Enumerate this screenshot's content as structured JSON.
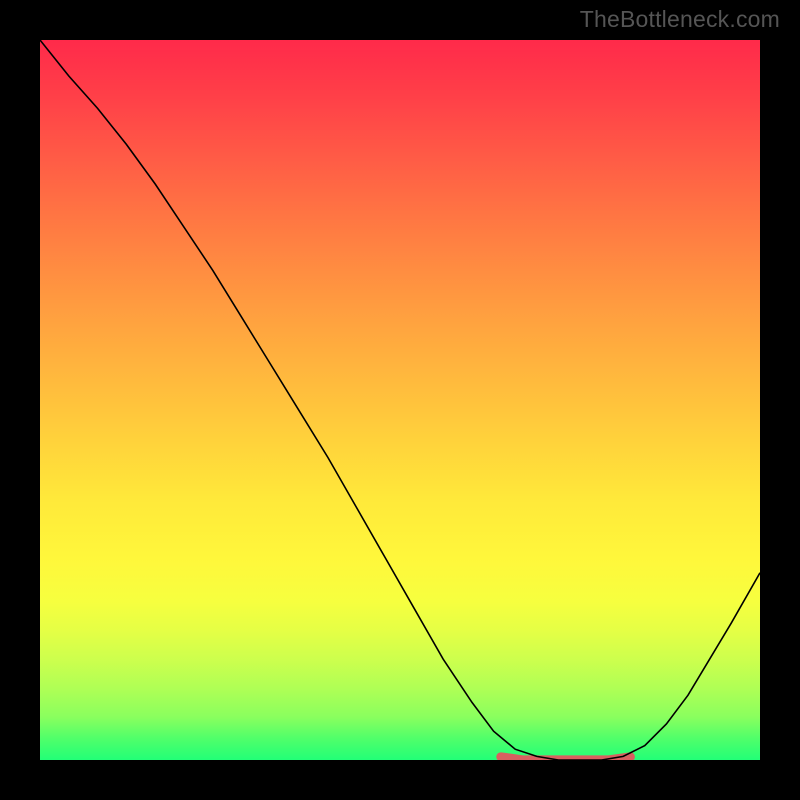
{
  "watermark": {
    "text": "TheBottleneck.com"
  },
  "colors": {
    "gradient_top": "#ff2a4a",
    "gradient_bottom": "#22ff77",
    "curve": "#000000",
    "highlight": "#d86060",
    "background": "#000000"
  },
  "chart_data": {
    "type": "line",
    "title": "",
    "xlabel": "",
    "ylabel": "",
    "xlim": [
      0,
      100
    ],
    "ylim": [
      0,
      100
    ],
    "grid": false,
    "legend": false,
    "series": [
      {
        "name": "curve",
        "x": [
          0,
          4,
          8,
          12,
          16,
          20,
          24,
          28,
          32,
          36,
          40,
          44,
          48,
          52,
          56,
          60,
          63,
          66,
          69,
          72,
          75,
          78,
          81,
          84,
          87,
          90,
          93,
          96,
          100
        ],
        "y": [
          100,
          95,
          90.5,
          85.5,
          80,
          74,
          68,
          61.5,
          55,
          48.5,
          42,
          35,
          28,
          21,
          14,
          8,
          4,
          1.5,
          0.5,
          0,
          0,
          0,
          0.5,
          2,
          5,
          9,
          14,
          19,
          26
        ]
      }
    ],
    "highlight_segment": {
      "x_start": 64,
      "x_end": 82,
      "y": 0.3
    }
  }
}
